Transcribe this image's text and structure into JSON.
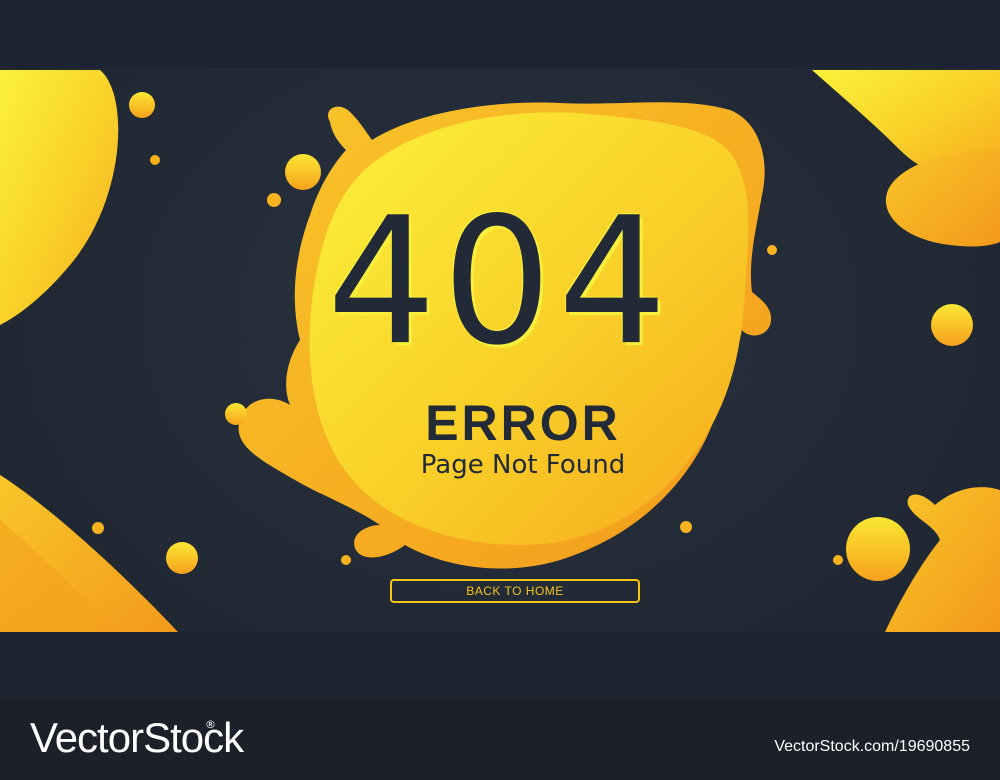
{
  "error": {
    "code": "404",
    "title": "ERROR",
    "subtitle": "Page Not Found",
    "button_label": "BACK TO HOME"
  },
  "footer": {
    "brand": "VectorStock",
    "reg_mark": "®",
    "stock_id": "VectorStock.com/19690855"
  },
  "colors": {
    "background": "#222a36",
    "accent_yellow": "#f7ef3c",
    "accent_orange": "#f7a21b",
    "text_dark": "#232a37"
  },
  "icons": [
    "paint-splash-blob",
    "circle-dot"
  ]
}
